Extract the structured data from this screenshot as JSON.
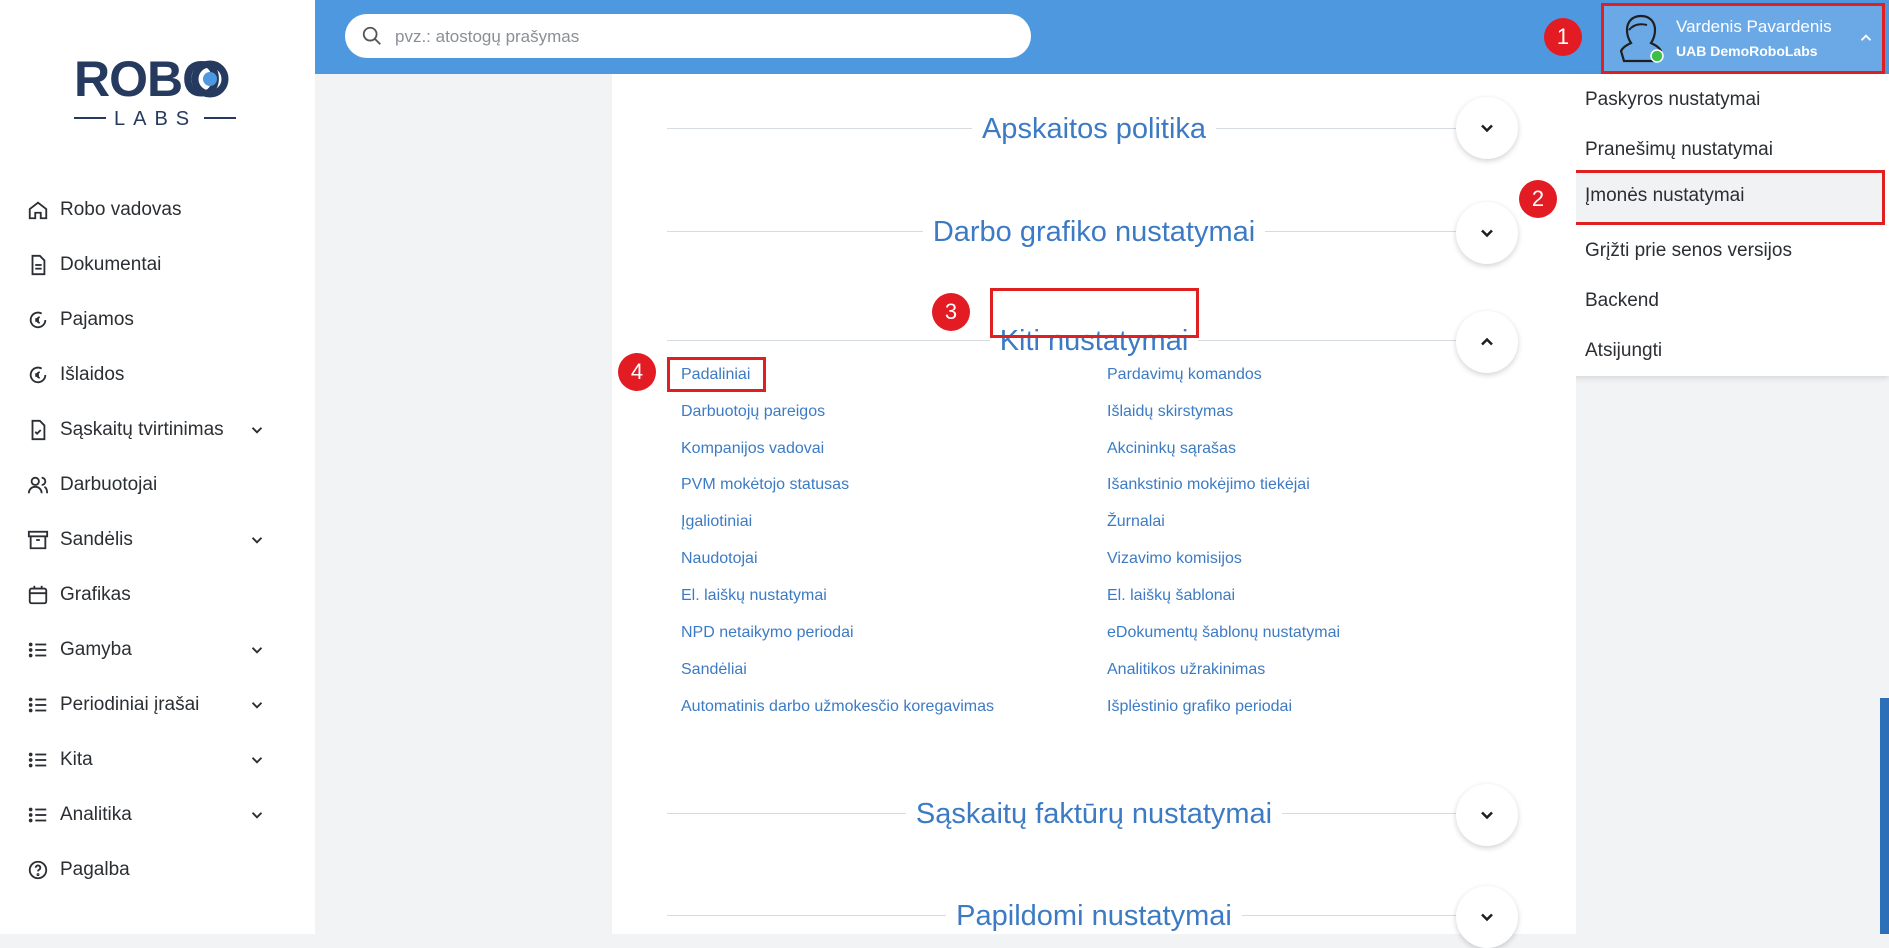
{
  "logo": {
    "top": "ROBO",
    "bottom": "LABS"
  },
  "search": {
    "placeholder": "pvz.: atostogų prašymas"
  },
  "user": {
    "name": "Vardenis Pavardenis",
    "company": "UAB DemoRoboLabs"
  },
  "sidebar": {
    "items": [
      {
        "label": "Robo vadovas",
        "icon": "home-icon"
      },
      {
        "label": "Dokumentai",
        "icon": "document-icon"
      },
      {
        "label": "Pajamos",
        "icon": "euro-income-icon"
      },
      {
        "label": "Išlaidos",
        "icon": "euro-expense-icon"
      },
      {
        "label": "Sąskaitų tvirtinimas",
        "icon": "file-check-icon"
      },
      {
        "label": "Darbuotojai",
        "icon": "users-icon"
      },
      {
        "label": "Sandėlis",
        "icon": "archive-icon"
      },
      {
        "label": "Grafikas",
        "icon": "calendar-icon"
      },
      {
        "label": "Gamyba",
        "icon": "list-icon"
      },
      {
        "label": "Periodiniai įrašai",
        "icon": "list-icon"
      },
      {
        "label": "Kita",
        "icon": "list-icon"
      },
      {
        "label": "Analitika",
        "icon": "list-icon"
      },
      {
        "label": "Pagalba",
        "icon": "help-icon"
      }
    ]
  },
  "dropdown": {
    "items": [
      "Paskyros nustatymai",
      "Pranešimų nustatymai",
      "Įmonės nustatymai",
      "Grįžti prie senos versijos",
      "Backend",
      "Atsijungti"
    ]
  },
  "badges": [
    "1",
    "2",
    "3",
    "4"
  ],
  "sections": [
    "Apskaitos politika",
    "Darbo grafiko nustatymai",
    "Kiti nustatymai",
    "Sąskaitų faktūrų nustatymai",
    "Papildomi nustatymai"
  ],
  "links_left": [
    "Padaliniai",
    "Darbuotojų pareigos",
    "Kompanijos vadovai",
    "PVM mokėtojo statusas",
    "Įgaliotiniai",
    "Naudotojai",
    "El. laiškų nustatymai",
    "NPD netaikymo periodai",
    "Sandėliai",
    "Automatinis darbo užmokesčio koregavimas"
  ],
  "links_right": [
    "Pardavimų komandos",
    "Išlaidų skirstymas",
    "Akcininkų sąrašas",
    "Išankstinio mokėjimo tiekėjai",
    "Žurnalai",
    "Vizavimo komisijos",
    "El. laiškų šablonai",
    "eDokumentų šablonų nustatymai",
    "Analitikos užrakinimas",
    "Išplėstinio grafiko periodai"
  ],
  "colors": {
    "topbar": "#4d98df",
    "accent": "#3c7bc4",
    "highlight": "#e02020",
    "badge": "#e31b23"
  }
}
